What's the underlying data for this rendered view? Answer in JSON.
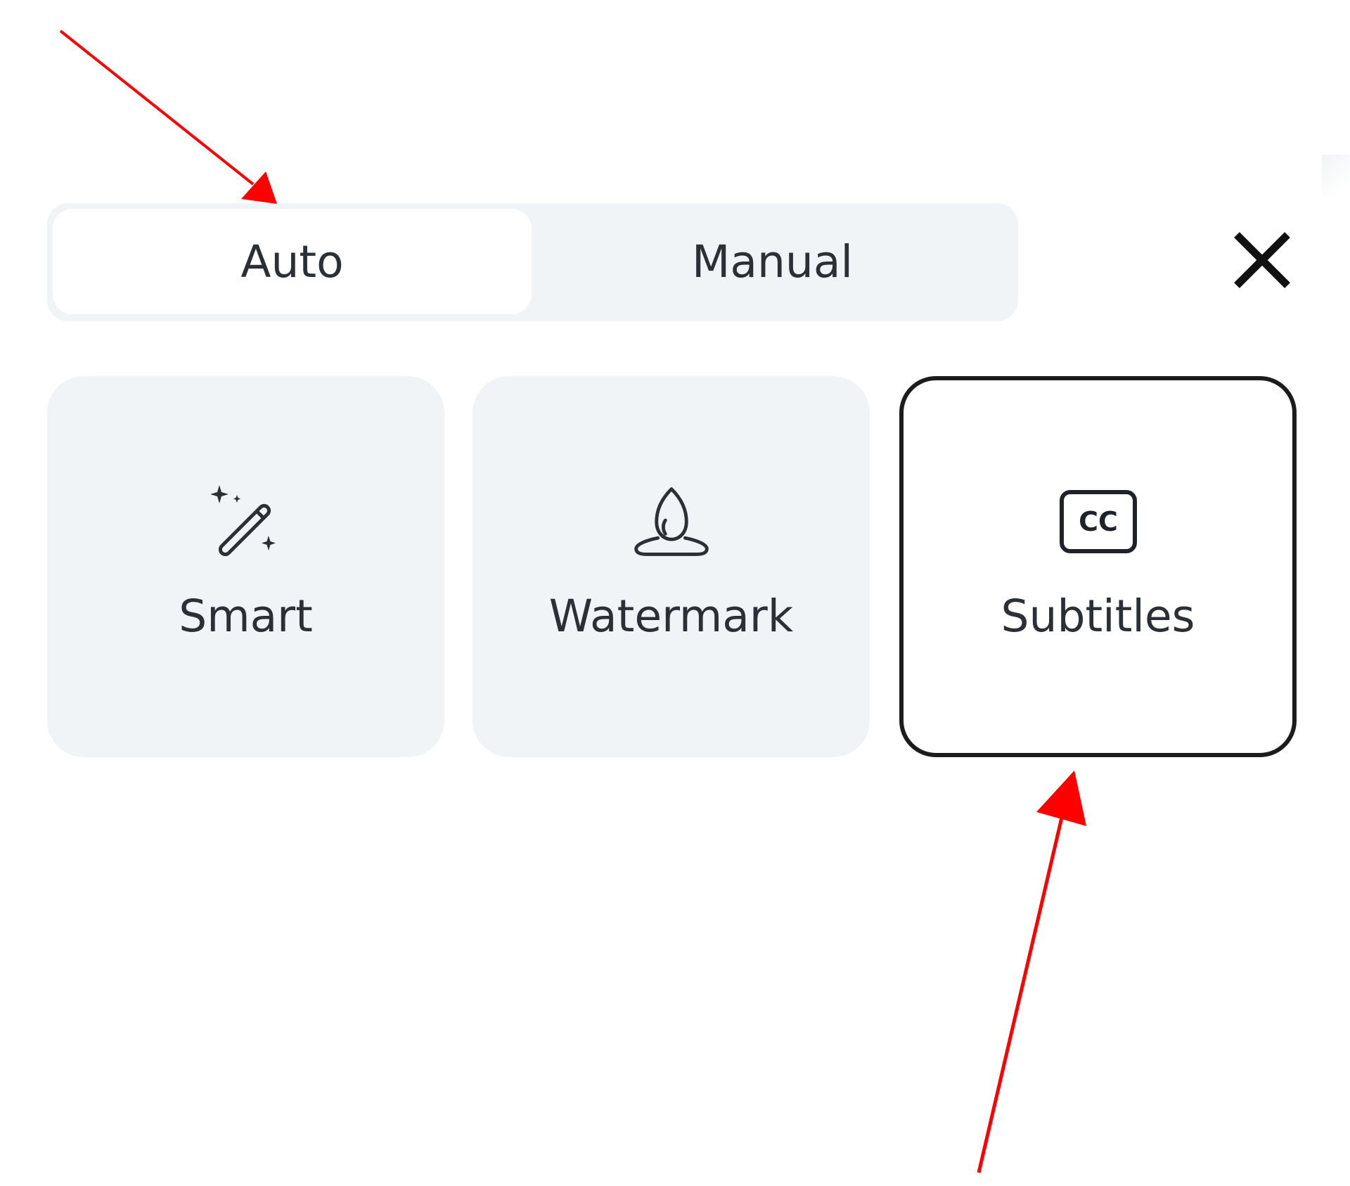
{
  "mode_toggle": {
    "options": [
      {
        "label": "Auto",
        "selected": true
      },
      {
        "label": "Manual",
        "selected": false
      }
    ]
  },
  "close": {
    "icon": "close-icon"
  },
  "options": [
    {
      "label": "Smart",
      "icon": "magic-wand-icon",
      "selected": false
    },
    {
      "label": "Watermark",
      "icon": "water-drop-icon",
      "selected": false
    },
    {
      "label": "Subtitles",
      "icon": "closed-captions-icon",
      "icon_text": "CC",
      "selected": true
    }
  ],
  "colors": {
    "annotation_arrow": "#ff0000",
    "selected_border": "#1c1c1c",
    "card_background": "#f1f4f7"
  }
}
